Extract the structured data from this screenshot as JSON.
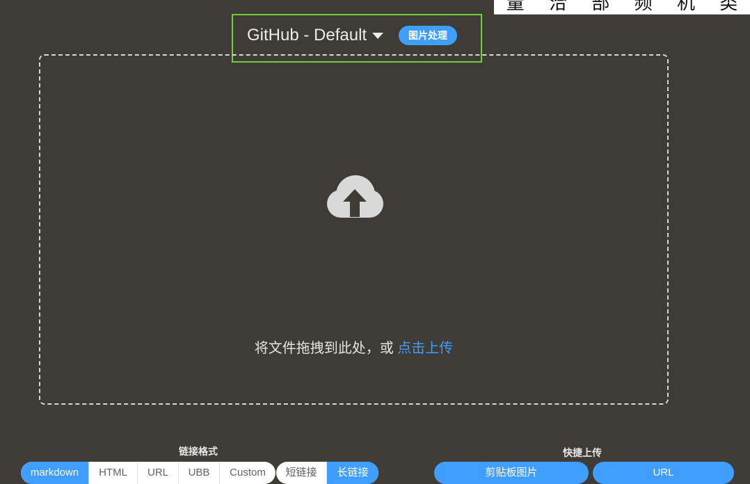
{
  "overlay": {
    "glyphs": [
      "量",
      "洽",
      "部",
      "频",
      "机",
      "类"
    ]
  },
  "header": {
    "picbed_name": "GitHub - Default",
    "image_process_label": "图片处理"
  },
  "dropzone": {
    "text": "将文件拖拽到此处，或",
    "link_text": "点击上传",
    "icon": "cloud-upload-icon"
  },
  "link_format": {
    "title": "链接格式",
    "options": [
      "markdown",
      "HTML",
      "URL",
      "UBB",
      "Custom"
    ],
    "selected": "markdown",
    "length_options": [
      "短链接",
      "长链接"
    ],
    "length_selected": "长链接"
  },
  "quick_upload": {
    "title": "快捷上传",
    "clipboard_label": "剪贴板图片",
    "url_label": "URL"
  },
  "colors": {
    "background": "#3f3b37",
    "accent": "#409eff",
    "highlight_border": "#6fd230"
  }
}
